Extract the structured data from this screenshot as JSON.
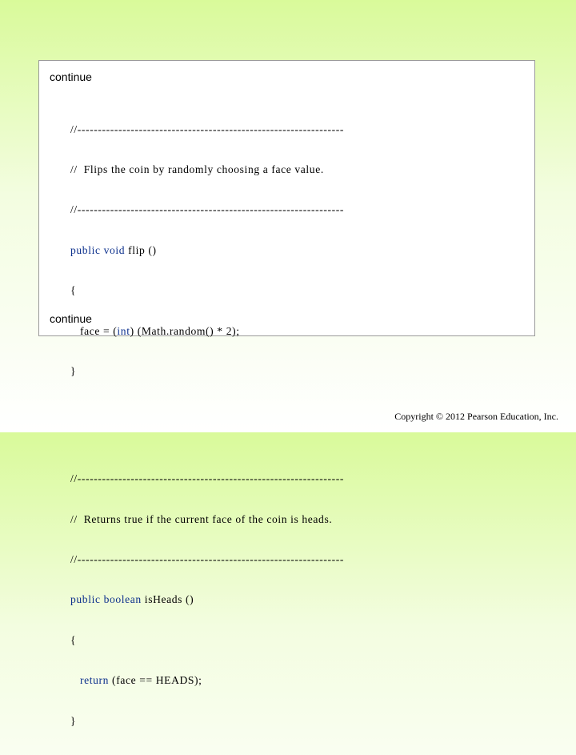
{
  "slide": {
    "continue_top": "continue",
    "continue_bottom": "continue",
    "footer": "Copyright © 2012 Pearson Education, Inc."
  },
  "code": {
    "flip": {
      "divider_top": "//-----------------------------------------------------------------",
      "comment": "//  Flips the coin by randomly choosing a face value.",
      "divider_bottom": "//-----------------------------------------------------------------",
      "sig_kw": "public void",
      "sig_rest": " flip ()",
      "open_brace": "{",
      "body_pre": "   face = (",
      "body_kw": "int",
      "body_post": ") (Math.random() * 2);",
      "close_brace": "}"
    },
    "isHeads": {
      "divider_top": "//-----------------------------------------------------------------",
      "comment": "//  Returns true if the current face of the coin is heads.",
      "divider_bottom": "//-----------------------------------------------------------------",
      "sig_kw": "public boolean",
      "sig_rest": " isHeads ()",
      "open_brace": "{",
      "body_indent": "   ",
      "body_kw": "return",
      "body_post": " (face == HEADS);",
      "close_brace": "}"
    }
  }
}
